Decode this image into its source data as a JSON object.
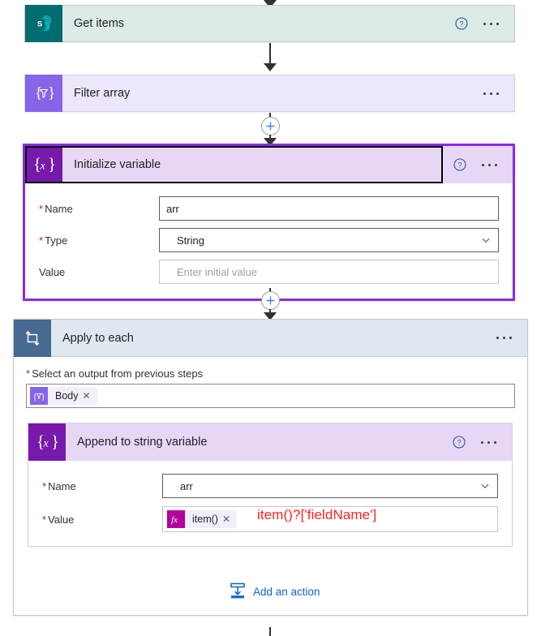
{
  "flow": {
    "steps": [
      {
        "id": "get-items",
        "title": "Get items",
        "icon": "sharepoint-icon",
        "help_icon": "help-icon",
        "menu_icon": "ellipsis-icon"
      },
      {
        "id": "filter-array",
        "title": "Filter array",
        "icon": "filter-array-icon",
        "menu_icon": "ellipsis-icon"
      },
      {
        "id": "initialize-variable",
        "title": "Initialize variable",
        "icon": "variable-icon",
        "help_icon": "help-icon",
        "menu_icon": "ellipsis-icon",
        "fields": [
          {
            "label": "Name",
            "required": true,
            "value": "arr",
            "control": "textbox"
          },
          {
            "label": "Type",
            "required": true,
            "value": "String",
            "control": "dropdown"
          },
          {
            "label": "Value",
            "required": false,
            "value": "",
            "placeholder": "Enter initial value",
            "control": "textbox"
          }
        ]
      },
      {
        "id": "apply-to-each",
        "title": "Apply to each",
        "icon": "loop-icon",
        "menu_icon": "ellipsis-icon",
        "input_label": "Select an output from previous steps",
        "input_required": true,
        "token": {
          "text": "Body",
          "icon": "filter-array-icon",
          "remove_icon": "close-icon"
        },
        "child": {
          "id": "append-to-string-variable",
          "title": "Append to string variable",
          "icon": "variable-icon",
          "help_icon": "help-icon",
          "menu_icon": "ellipsis-icon",
          "fields": [
            {
              "label": "Name",
              "required": true,
              "value": "arr",
              "control": "dropdown"
            },
            {
              "label": "Value",
              "required": true,
              "control": "token",
              "token": {
                "text": "item()",
                "icon": "fx-icon",
                "remove_icon": "close-icon"
              }
            }
          ]
        },
        "add_action": {
          "label": "Add an action",
          "icon": "add-action-icon"
        }
      }
    ],
    "annotation": "item()?['fieldName']",
    "add_step_buttons": [
      {
        "name": "insert-step-after-filter-array"
      },
      {
        "name": "insert-step-after-initialize-variable"
      }
    ]
  },
  "colors": {
    "sharepoint_teal": "#036c70",
    "variable_purple": "#7719aa",
    "filter_purple": "#8764e8",
    "loop_blue": "#486991",
    "fx_magenta": "#b4009e",
    "link_blue": "#0f62cb",
    "annotation_red": "#ff2121",
    "selected_border": "#8a2be2",
    "required_red": "#a4262c"
  }
}
